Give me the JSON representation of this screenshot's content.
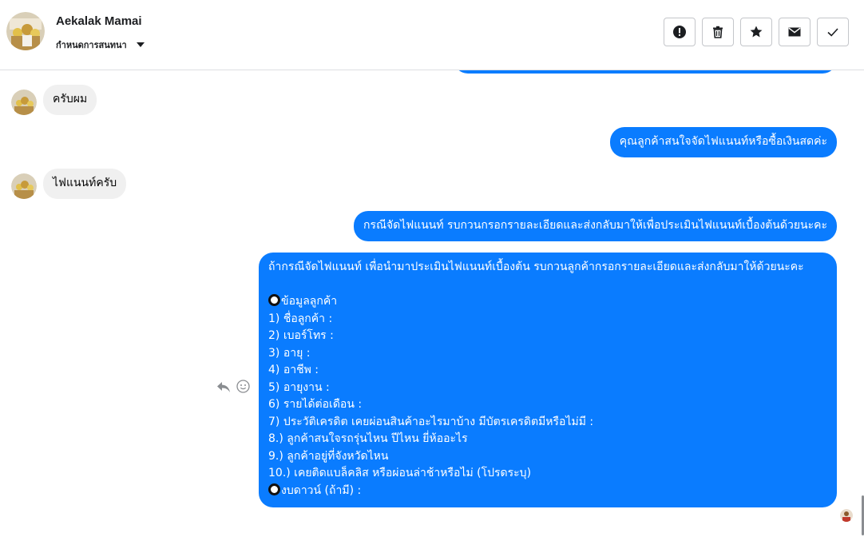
{
  "header": {
    "contact_name": "Aekalak Mamai",
    "subtitle": "กำหนดการสนทนา",
    "actions": [
      {
        "name": "mark-spam-button",
        "icon": "exclamation-circle-icon"
      },
      {
        "name": "delete-button",
        "icon": "trash-icon"
      },
      {
        "name": "star-button",
        "icon": "star-icon"
      },
      {
        "name": "mark-unread-button",
        "icon": "envelope-icon"
      },
      {
        "name": "mark-done-button",
        "icon": "check-icon"
      }
    ]
  },
  "messages": [
    {
      "side": "in",
      "text": "ครับผม"
    },
    {
      "side": "out",
      "text": "คุณลูกค้าสนใจจัดไฟแนนท์หรือซื้อเงินสดค่ะ"
    },
    {
      "side": "in",
      "text": "ไฟแนนท์ครับ"
    },
    {
      "side": "out",
      "text": "กรณีจัดไฟแนนท์ รบกวนกรอกรายละเอียดและส่งกลับมาให้เพื่อประเมินไฟแนนท์เบื้องต้นด้วยนะคะ"
    },
    {
      "side": "out",
      "intro": "ถ้ากรณีจัดไฟแนนท์ เพื่อนำมาประเมินไฟแนนท์เบื้องต้น รบกวนลูกค้ากรอกรายละเอียดและส่งกลับมาให้ด้วยนะคะ",
      "section_title": "ข้อมูลลูกค้า",
      "items": [
        "1) ชื่อลูกค้า :",
        "2) เบอร์โทร :",
        "3) อายุ :",
        "4) อาชีพ :",
        "5) อายุงาน :",
        "6) รายได้ต่อเดือน :",
        "7) ประวัติเครดิต เคยผ่อนสินค้าอะไรมาบ้าง มีบัตรเครดิตมีหรือไม่มี :",
        "8.) ลูกค้าสนใจรถรุ่นไหน ปีไหน ยี่ห้ออะไร",
        "9.) ลูกค้าอยู่ที่จังหวัดไหน",
        "10.) เคยติดแบล็คลิส หรือผ่อนล่าช้าหรือไม่ (โปรดระบุ)"
      ],
      "footer": "งบดาวน์ (ถ้ามี) :"
    }
  ],
  "colors": {
    "outgoing": "#0a7cff",
    "incoming": "#f0f0f0"
  }
}
